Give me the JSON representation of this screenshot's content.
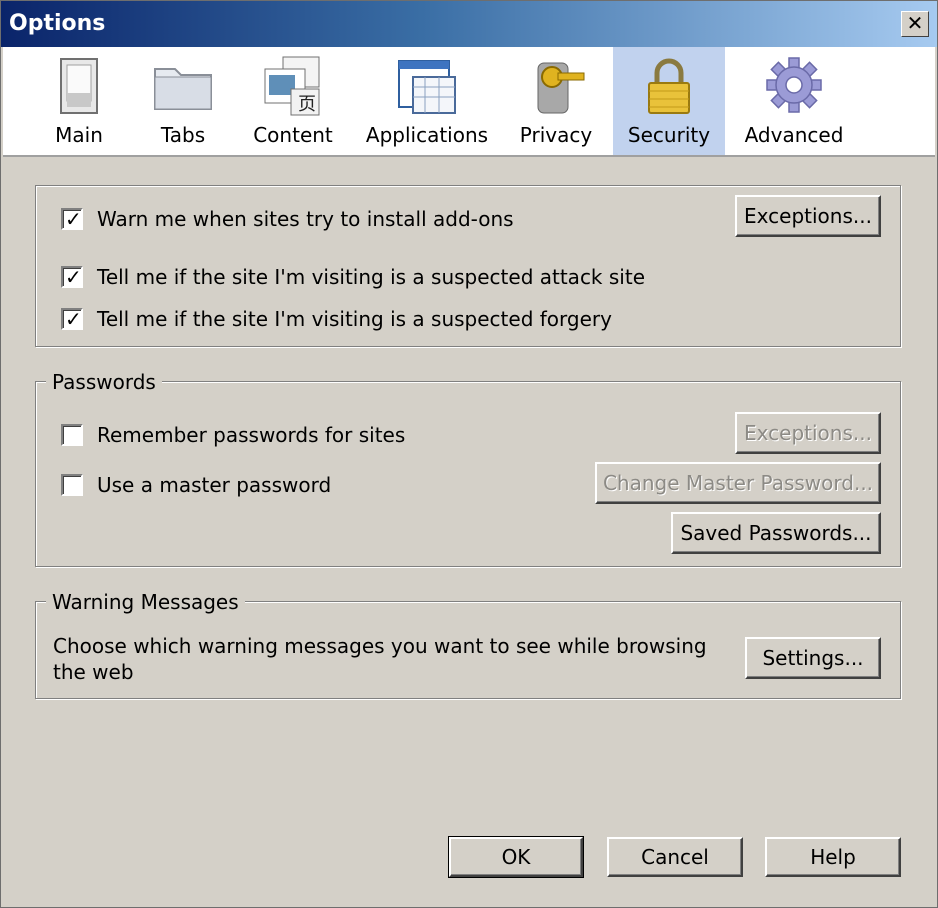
{
  "window": {
    "title": "Options",
    "close_glyph": "✕"
  },
  "toolbar": {
    "tabs": [
      {
        "label": "Main",
        "icon": "switch-icon"
      },
      {
        "label": "Tabs",
        "icon": "folder-icon"
      },
      {
        "label": "Content",
        "icon": "content-icon"
      },
      {
        "label": "Applications",
        "icon": "applications-icon"
      },
      {
        "label": "Privacy",
        "icon": "privacy-key-icon"
      },
      {
        "label": "Security",
        "icon": "padlock-icon",
        "selected": true
      },
      {
        "label": "Advanced",
        "icon": "gear-icon"
      }
    ]
  },
  "security": {
    "addons": {
      "label": "Warn me when sites try to install add-ons",
      "checked": true
    },
    "addons_exceptions": "Exceptions...",
    "attack_site": {
      "label": "Tell me if the site I'm visiting is a suspected attack site",
      "checked": true
    },
    "forgery": {
      "label": "Tell me if the site I'm visiting is a suspected forgery",
      "checked": true
    }
  },
  "passwords": {
    "legend": "Passwords",
    "remember": {
      "label": "Remember passwords for sites",
      "checked": false
    },
    "exceptions": "Exceptions...",
    "master": {
      "label": "Use a master password",
      "checked": false
    },
    "change_master": "Change Master Password...",
    "saved": "Saved Passwords..."
  },
  "warnings": {
    "legend": "Warning Messages",
    "text": "Choose which warning messages you want to see while browsing the web",
    "settings": "Settings..."
  },
  "footer": {
    "ok": "OK",
    "cancel": "Cancel",
    "help": "Help"
  },
  "colors": {
    "titlebar_start": "#0a246a",
    "selected_tab": "#c1d2ee",
    "dialog_bg": "#d4d0c8"
  }
}
